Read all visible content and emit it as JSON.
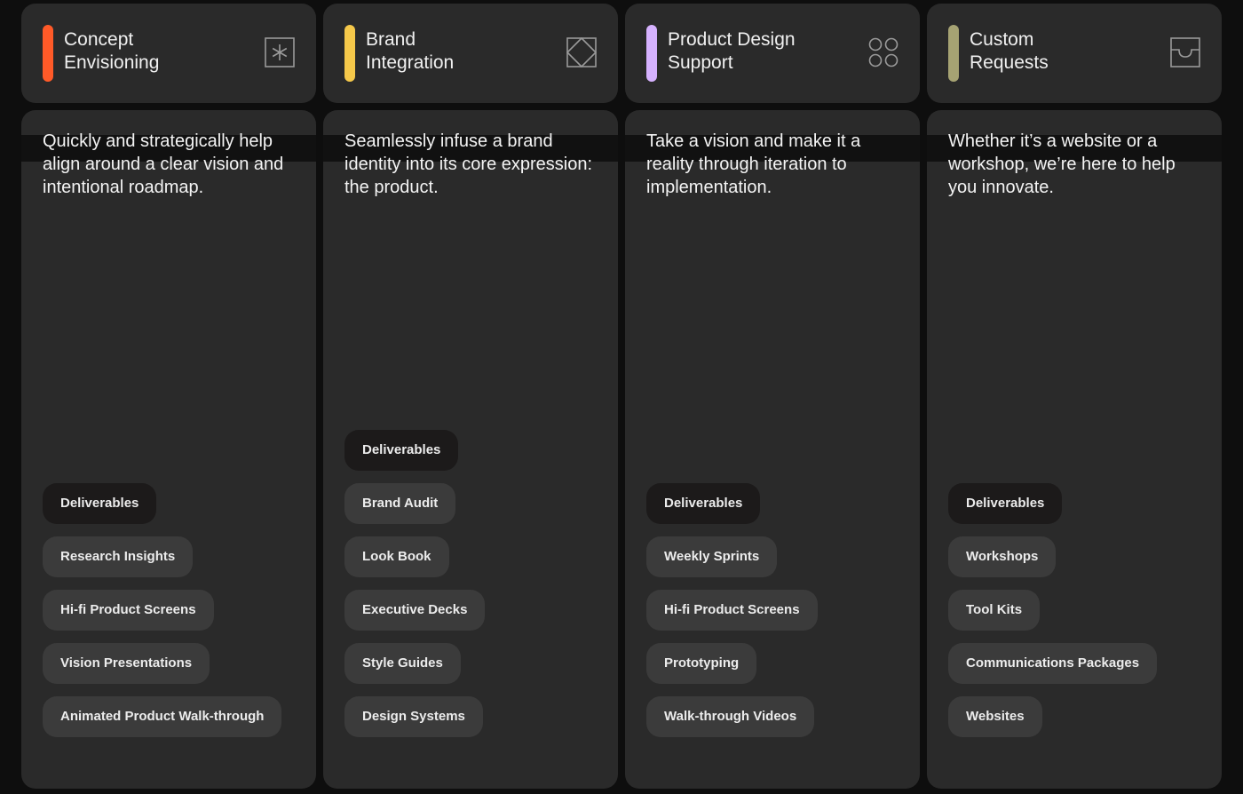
{
  "columns": [
    {
      "title_line1": "Concept",
      "title_line2": "Envisioning",
      "accent": "#ff5a28",
      "icon": "asterisk-box-icon",
      "description": "Quickly and strategically help align around a clear vision and intentional roadmap.",
      "deliverables_label": "Deliverables",
      "items": [
        "Research Insights",
        "Hi-fi Product Screens",
        "Vision Presentations",
        "Animated Product Walk-through"
      ]
    },
    {
      "title_line1": "Brand",
      "title_line2": "Integration",
      "accent": "#f5c84a",
      "icon": "diamond-box-icon",
      "description": "Seamlessly infuse a brand identity into its core expression: the product.",
      "deliverables_label": "Deliverables",
      "items": [
        "Brand Audit",
        "Look Book",
        "Executive Decks",
        "Style Guides",
        "Design Systems"
      ]
    },
    {
      "title_line1": "Product Design",
      "title_line2": "Support",
      "accent": "#d6b2ff",
      "icon": "four-circles-icon",
      "description": "Take a vision and make it a reality through iteration to implementation.",
      "deliverables_label": "Deliverables",
      "items": [
        "Weekly Sprints",
        "Hi-fi Product Screens",
        "Prototyping",
        "Walk-through Videos"
      ]
    },
    {
      "title_line1": "Custom",
      "title_line2": "Requests",
      "accent": "#a6a373",
      "icon": "tray-icon",
      "description": "Whether it’s a website or a workshop, we’re here to help you innovate.",
      "deliverables_label": "Deliverables",
      "items": [
        "Workshops",
        "Tool Kits",
        "Communications Packages",
        "Websites"
      ]
    }
  ]
}
